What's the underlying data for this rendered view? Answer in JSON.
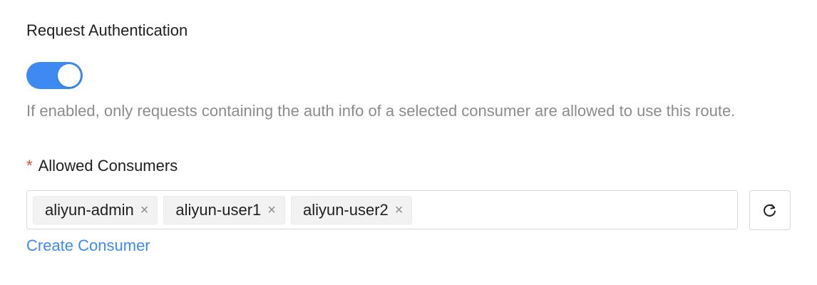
{
  "section": {
    "title": "Request Authentication"
  },
  "toggle": {
    "enabled": true,
    "accent_color": "#3d8bf2"
  },
  "help": {
    "text": "If enabled, only requests containing the auth info of a selected consumer are allowed to use this route."
  },
  "consumers": {
    "required_mark": "*",
    "label": "Allowed Consumers",
    "tags": [
      {
        "label": "aliyun-admin",
        "remove": "×"
      },
      {
        "label": "aliyun-user1",
        "remove": "×"
      },
      {
        "label": "aliyun-user2",
        "remove": "×"
      }
    ],
    "refresh_icon": "refresh-icon",
    "create_link": "Create Consumer"
  }
}
